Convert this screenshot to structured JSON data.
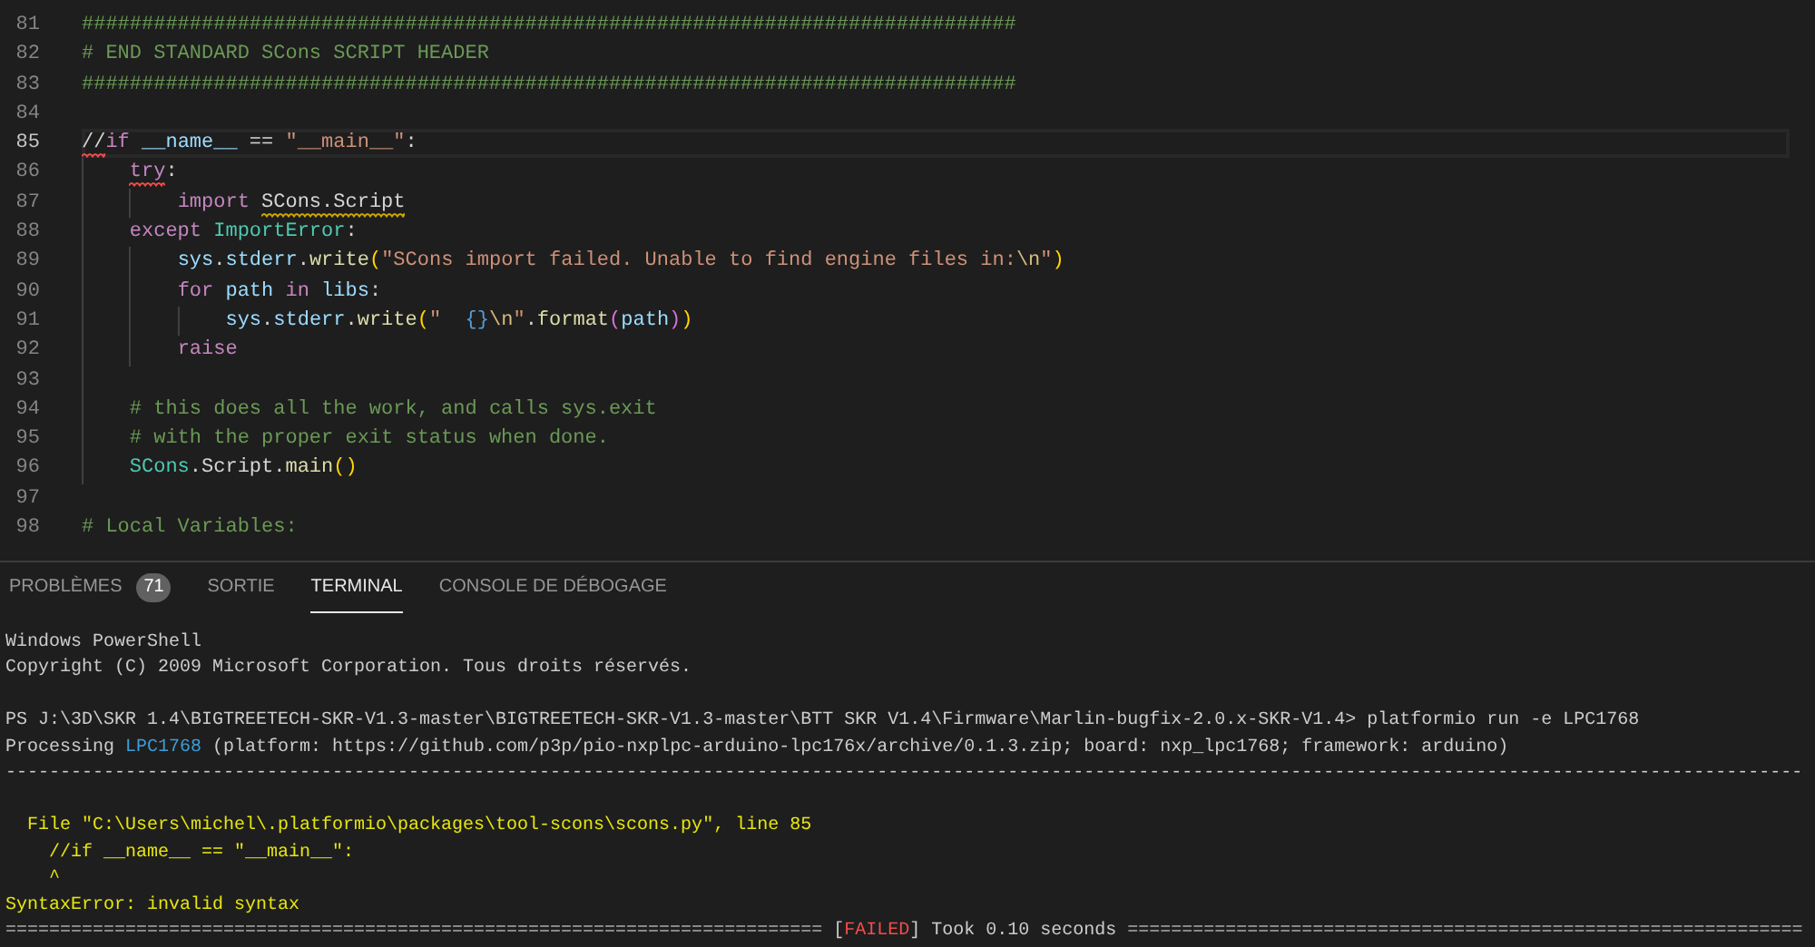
{
  "editor": {
    "lines": [
      {
        "number": "81",
        "current": false,
        "tokens": [
          {
            "text": "##############################################################################",
            "kind": "comment"
          }
        ]
      },
      {
        "number": "82",
        "current": false,
        "tokens": [
          {
            "text": "# END STANDARD SCons SCRIPT HEADER",
            "kind": "comment"
          }
        ]
      },
      {
        "number": "83",
        "current": false,
        "tokens": [
          {
            "text": "##############################################################################",
            "kind": "comment"
          }
        ]
      },
      {
        "number": "84",
        "current": false
      },
      {
        "number": "85",
        "current": true,
        "tokens": [
          {
            "text": "//",
            "kind": "plain",
            "error": true
          },
          {
            "text": "if ",
            "kind": "keyword"
          },
          {
            "text": "__name__",
            "kind": "variable"
          },
          {
            "text": " == ",
            "kind": "plain"
          },
          {
            "text": "\"__main__\"",
            "kind": "string"
          },
          {
            "text": ":",
            "kind": "plain"
          }
        ]
      },
      {
        "number": "86",
        "current": false,
        "tokens": [
          {
            "text": "    try",
            "kind": "keyword",
            "error": true
          },
          {
            "text": ":",
            "kind": "plain"
          }
        ]
      },
      {
        "number": "87",
        "current": false,
        "tokens": [
          {
            "text": "        import ",
            "kind": "keyword"
          },
          {
            "text": "SCons.Script",
            "kind": "plain",
            "warning": true
          }
        ]
      },
      {
        "number": "88",
        "current": false,
        "tokens": [
          {
            "text": "    except ",
            "kind": "keyword"
          },
          {
            "text": "ImportError",
            "kind": "class"
          },
          {
            "text": ":",
            "kind": "plain"
          }
        ]
      },
      {
        "number": "89",
        "current": false,
        "tokens": [
          {
            "text": "        sys",
            "kind": "variable"
          },
          {
            "text": ".",
            "kind": "plain"
          },
          {
            "text": "stderr",
            "kind": "variable"
          },
          {
            "text": ".",
            "kind": "plain"
          },
          {
            "text": "write",
            "kind": "function"
          },
          {
            "text": "(",
            "kind": "bracket"
          },
          {
            "text": "\"SCons import failed. Unable to find engine files in:",
            "kind": "string"
          },
          {
            "text": "\\n",
            "kind": "escape"
          },
          {
            "text": "\"",
            "kind": "string"
          },
          {
            "text": ")",
            "kind": "bracket"
          }
        ]
      },
      {
        "number": "90",
        "current": false,
        "tokens": [
          {
            "text": "        for ",
            "kind": "keyword"
          },
          {
            "text": "path ",
            "kind": "variable"
          },
          {
            "text": "in ",
            "kind": "keyword"
          },
          {
            "text": "libs",
            "kind": "variable"
          },
          {
            "text": ":",
            "kind": "plain"
          }
        ]
      },
      {
        "number": "91",
        "current": false,
        "tokens": [
          {
            "text": "            sys",
            "kind": "variable"
          },
          {
            "text": ".",
            "kind": "plain"
          },
          {
            "text": "stderr",
            "kind": "variable"
          },
          {
            "text": ".",
            "kind": "plain"
          },
          {
            "text": "write",
            "kind": "function"
          },
          {
            "text": "(",
            "kind": "bracket"
          },
          {
            "text": "\"  ",
            "kind": "string"
          },
          {
            "text": "{}",
            "kind": "placeholder"
          },
          {
            "text": "\\n",
            "kind": "escape"
          },
          {
            "text": "\"",
            "kind": "string"
          },
          {
            "text": ".",
            "kind": "plain"
          },
          {
            "text": "format",
            "kind": "function"
          },
          {
            "text": "(",
            "kind": "innerbracket"
          },
          {
            "text": "path",
            "kind": "variable"
          },
          {
            "text": ")",
            "kind": "innerbracket"
          },
          {
            "text": ")",
            "kind": "bracket"
          }
        ]
      },
      {
        "number": "92",
        "current": false,
        "tokens": [
          {
            "text": "        raise",
            "kind": "keyword"
          }
        ]
      },
      {
        "number": "93",
        "current": false
      },
      {
        "number": "94",
        "current": false,
        "tokens": [
          {
            "text": "    # this does all the work, and calls sys.exit",
            "kind": "comment"
          }
        ]
      },
      {
        "number": "95",
        "current": false,
        "tokens": [
          {
            "text": "    # with the proper exit status when done.",
            "kind": "comment"
          }
        ]
      },
      {
        "number": "96",
        "current": false,
        "tokens": [
          {
            "text": "    SCons",
            "kind": "class"
          },
          {
            "text": ".Script.",
            "kind": "plain"
          },
          {
            "text": "main",
            "kind": "function"
          },
          {
            "text": "()",
            "kind": "bracket"
          }
        ]
      },
      {
        "number": "97",
        "current": false
      },
      {
        "number": "98",
        "current": false,
        "tokens": [
          {
            "text": "# Local Variables:",
            "kind": "comment"
          }
        ]
      }
    ]
  },
  "panel": {
    "tabs": [
      {
        "label": "PROBLÈMES",
        "badge": "71",
        "selected": false
      },
      {
        "label": "SORTIE",
        "selected": false
      },
      {
        "label": "TERMINAL",
        "selected": true
      },
      {
        "label": "CONSOLE DE DÉBOGAGE",
        "selected": false
      }
    ],
    "terminal": {
      "blocks": [
        {
          "lines": [
            {
              "tokens": [
                {
                  "text": "Windows PowerShell",
                  "kind": "plain"
                }
              ]
            },
            {
              "tokens": [
                {
                  "text": "Copyright (C) 2009 Microsoft Corporation. Tous droits réservés.",
                  "kind": "plain"
                }
              ]
            }
          ]
        },
        {
          "lines": [
            {
              "tokens": [
                {
                  "text": "PS J:\\3D\\SKR 1.4\\BIGTREETECH-SKR-V1.3-master\\BIGTREETECH-SKR-V1.3-master\\BTT SKR V1.4\\Firmware\\Marlin-bugfix-2.0.x-SKR-V1.4> platformio run -e LPC1768",
                  "kind": "plain"
                }
              ]
            },
            {
              "tokens": [
                {
                  "text": "Processing ",
                  "kind": "plain"
                },
                {
                  "text": "LPC1768",
                  "kind": "highlight"
                },
                {
                  "text": " (platform: https://github.com/p3p/pio-nxplpc-arduino-lpc176x/archive/0.1.3.zip; board: nxp_lpc1768; framework: arduino)",
                  "kind": "plain"
                }
              ]
            },
            {
              "tokens": [
                {
                  "text": "---------------------------------------------------------------------------------------------------------------------------------------------------------------------",
                  "kind": "plain"
                }
              ]
            }
          ]
        },
        {
          "lines": [
            {
              "tokens": [
                {
                  "text": "  File \"C:\\Users\\michel\\.platformio\\packages\\tool-scons\\scons.py\", line 85",
                  "kind": "warning"
                }
              ]
            },
            {
              "tokens": [
                {
                  "text": "    //if __name__ == \"__main__\":",
                  "kind": "warning"
                }
              ]
            },
            {
              "tokens": [
                {
                  "text": "    ^",
                  "kind": "warning"
                }
              ]
            },
            {
              "tokens": [
                {
                  "text": "SyntaxError: invalid syntax",
                  "kind": "warning"
                }
              ]
            },
            {
              "tokens": [
                {
                  "text": "=========================================================================== ",
                  "kind": "muted"
                },
                {
                  "text": "[",
                  "kind": "plain"
                },
                {
                  "text": "FAILED",
                  "kind": "error"
                },
                {
                  "text": "]",
                  "kind": "plain"
                },
                {
                  "text": " Took 0.10 seconds ",
                  "kind": "plain"
                },
                {
                  "text": "==============================================================",
                  "kind": "muted"
                }
              ]
            }
          ]
        }
      ]
    }
  }
}
